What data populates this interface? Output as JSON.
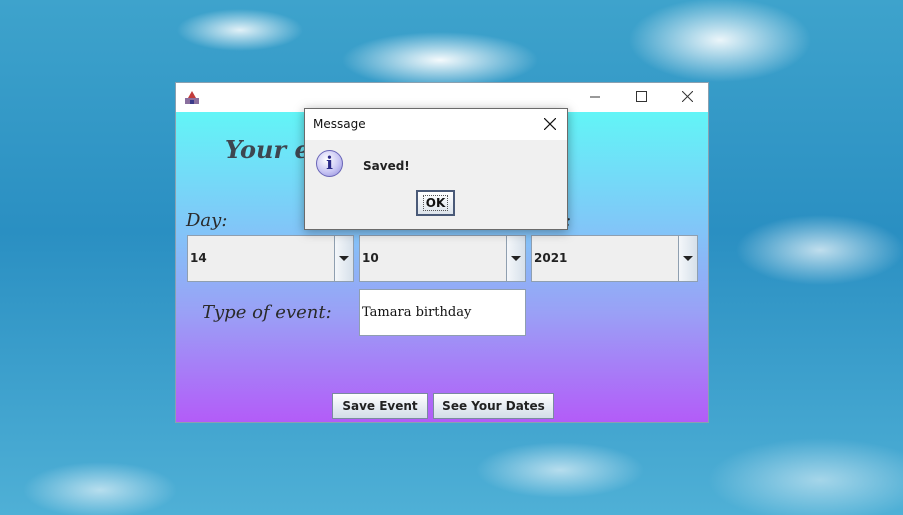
{
  "main_window": {
    "heading": "Your ev",
    "day_label": "Day:",
    "year_label_fragment": ":",
    "day": {
      "value": "14"
    },
    "month": {
      "value": "10"
    },
    "year": {
      "value": "2021"
    },
    "event_type_label": "Type of event:",
    "event_type_value": "Tamara birthday",
    "save_button": "Save Event",
    "see_dates_button": "See Your Dates"
  },
  "dialog": {
    "title": "Message",
    "message": "Saved!",
    "ok_label": "OK",
    "icon": "info-icon"
  },
  "icons": {
    "app": "app-icon",
    "minimize": "minimize-icon",
    "maximize": "maximize-icon",
    "close": "close-icon",
    "dropdown": "chevron-down-icon"
  },
  "colors": {
    "gradient_top": "#62f5f7",
    "gradient_bottom": "#b35cf8"
  }
}
